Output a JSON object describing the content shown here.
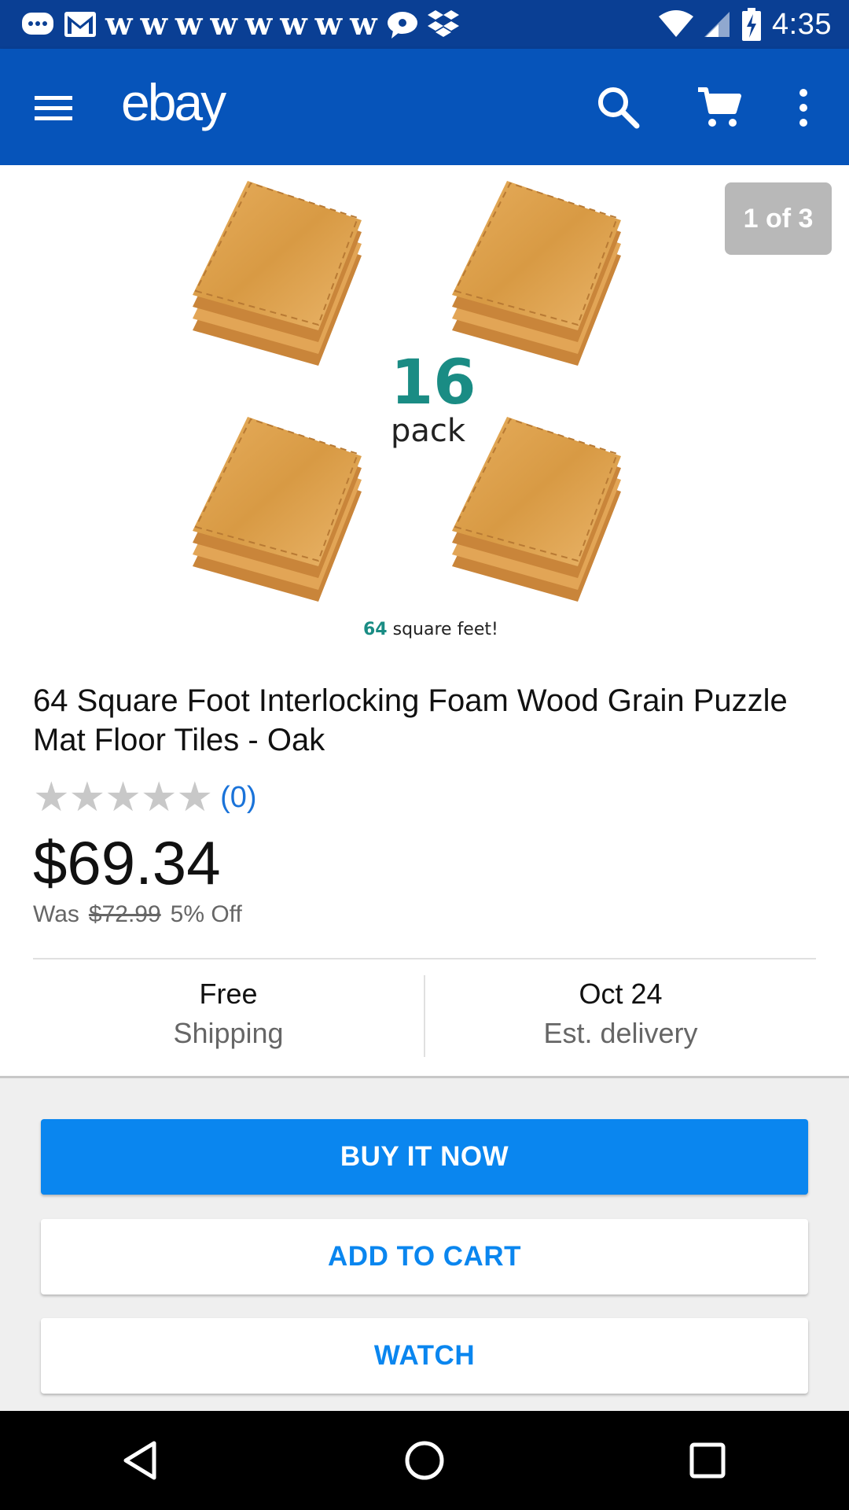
{
  "status_bar": {
    "time": "4:35",
    "notification_glyph": "w",
    "icons": [
      "chat-bubble-icon",
      "gmail-icon",
      "w-app-icon",
      "messenger-icon",
      "dropbox-icon",
      "wifi-icon",
      "signal-icon",
      "battery-charging-icon"
    ]
  },
  "app_bar": {
    "logo": "ebay",
    "icons": [
      "menu-icon",
      "search-icon",
      "cart-icon",
      "more-vert-icon"
    ],
    "color": "#0654ba"
  },
  "gallery": {
    "counter": "1 of 3",
    "pack_number": "16",
    "pack_word": "pack",
    "sqft_number": "64",
    "sqft_text": "square feet!"
  },
  "product": {
    "title": "64 Square Foot Interlocking Foam Wood Grain Puzzle Mat Floor Tiles - Oak",
    "rating_count": "(0)",
    "stars_filled": 0,
    "stars_total": 5,
    "price": "$69.34",
    "was_label": "Was",
    "was_price": "$72.99",
    "discount": "5% Off"
  },
  "info": {
    "shipping_main": "Free",
    "shipping_sub": "Shipping",
    "delivery_main": "Oct 24",
    "delivery_sub": "Est. delivery"
  },
  "actions": {
    "buy_now": "BUY IT NOW",
    "add_to_cart": "ADD TO CART",
    "watch": "WATCH",
    "accent": "#0a86ef"
  },
  "nav": {
    "icons": [
      "back-icon",
      "home-icon",
      "recents-icon"
    ]
  }
}
